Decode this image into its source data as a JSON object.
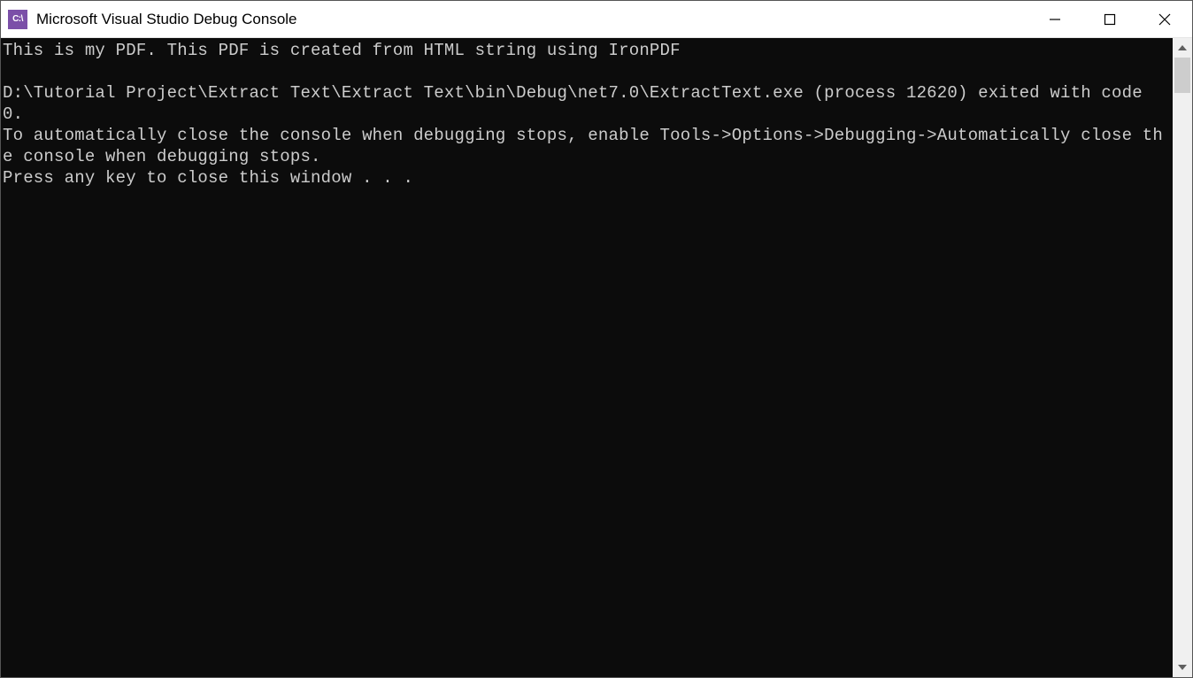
{
  "window": {
    "title": "Microsoft Visual Studio Debug Console",
    "icon_label": "C:\\"
  },
  "console": {
    "lines": [
      "This is my PDF. This PDF is created from HTML string using IronPDF",
      "",
      "D:\\Tutorial Project\\Extract Text\\Extract Text\\bin\\Debug\\net7.0\\ExtractText.exe (process 12620) exited with code 0.",
      "To automatically close the console when debugging stops, enable Tools->Options->Debugging->Automatically close the console when debugging stops.",
      "Press any key to close this window . . ."
    ]
  }
}
